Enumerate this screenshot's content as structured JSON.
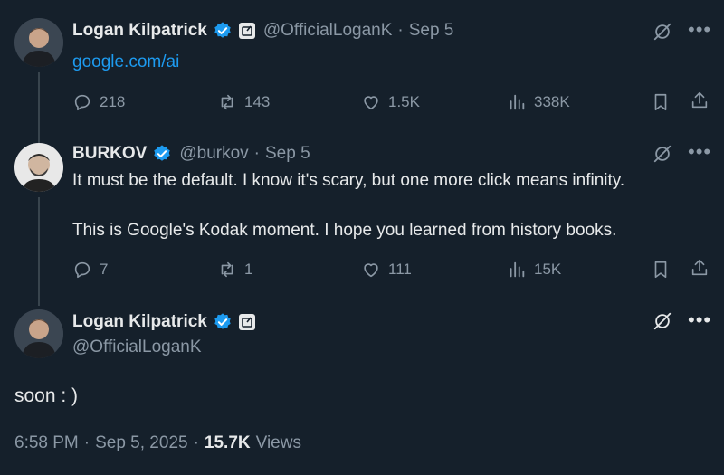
{
  "tweet1": {
    "name": "Logan Kilpatrick",
    "handle": "@OfficialLoganK",
    "sep": "·",
    "date": "Sep 5",
    "link": "google.com/ai",
    "replies": "218",
    "retweets": "143",
    "likes": "1.5K",
    "views": "338K"
  },
  "tweet2": {
    "name": "BURKOV",
    "handle": "@burkov",
    "sep": "·",
    "date": "Sep 5",
    "line1": "It must be the default. I know it's scary, but one more click means infinity.",
    "line2": "This is Google's Kodak moment. I hope you learned from history books.",
    "replies": "7",
    "retweets": "1",
    "likes": "111",
    "views": "15K"
  },
  "main": {
    "name": "Logan Kilpatrick",
    "handle": "@OfficialLoganK",
    "text": "soon : )",
    "time": "6:58 PM",
    "sep1": "·",
    "date": "Sep 5, 2025",
    "sep2": "·",
    "views_count": "15.7K",
    "views_label": "Views"
  },
  "colors": {
    "background": "#15202b",
    "accent": "#1d9bf0",
    "muted": "#8b98a5",
    "text": "#e7e9ea"
  },
  "icons": [
    "more-icon",
    "grok-icon",
    "reply-icon",
    "retweet-icon",
    "like-icon",
    "views-icon",
    "bookmark-icon",
    "share-icon",
    "verified-badge-icon",
    "affiliate-badge-icon"
  ]
}
